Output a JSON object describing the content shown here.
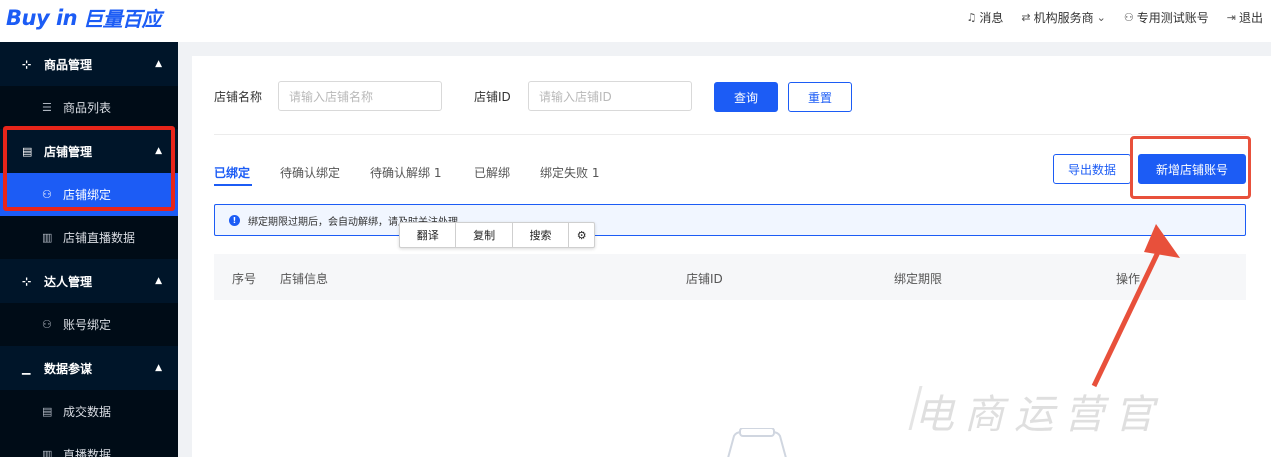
{
  "header": {
    "logo_text": "Buy in",
    "logo_cn": "巨量百应",
    "messages": "消息",
    "org_service": "机构服务商",
    "account": "专用测试账号",
    "logout": "退出"
  },
  "sidebar": {
    "groups": [
      {
        "label": "商品管理",
        "items": [
          {
            "label": "商品列表"
          }
        ]
      },
      {
        "label": "店铺管理",
        "items": [
          {
            "label": "店铺绑定"
          },
          {
            "label": "店铺直播数据"
          }
        ]
      },
      {
        "label": "达人管理",
        "items": [
          {
            "label": "账号绑定"
          }
        ]
      },
      {
        "label": "数据参谋",
        "items": [
          {
            "label": "成交数据"
          },
          {
            "label": "直播数据"
          }
        ]
      }
    ]
  },
  "filters": {
    "store_name_label": "店铺名称",
    "store_name_placeholder": "请输入店铺名称",
    "store_id_label": "店铺ID",
    "store_id_placeholder": "请输入店铺ID",
    "query_button": "查询",
    "reset_button": "重置"
  },
  "tabs": [
    {
      "label": "已绑定",
      "active": true
    },
    {
      "label": "待确认绑定",
      "active": false
    },
    {
      "label": "待确认解绑 1",
      "active": false
    },
    {
      "label": "已解绑",
      "active": false
    },
    {
      "label": "绑定失败 1",
      "active": false
    }
  ],
  "actions": {
    "export": "导出数据",
    "add_store": "新增店铺账号"
  },
  "notice": {
    "text": "绑定期限过期后，会自动解绑，请及时关注处理"
  },
  "context_menu": {
    "translate": "翻译",
    "copy": "复制",
    "search": "搜索"
  },
  "table": {
    "columns": [
      "序号",
      "店铺信息",
      "店铺ID",
      "绑定期限",
      "操作"
    ]
  },
  "watermark": "电商运营官",
  "colors": {
    "accent": "#1c5cf5",
    "sidebar_bg": "#001529",
    "highlight_red": "#e8251a"
  }
}
